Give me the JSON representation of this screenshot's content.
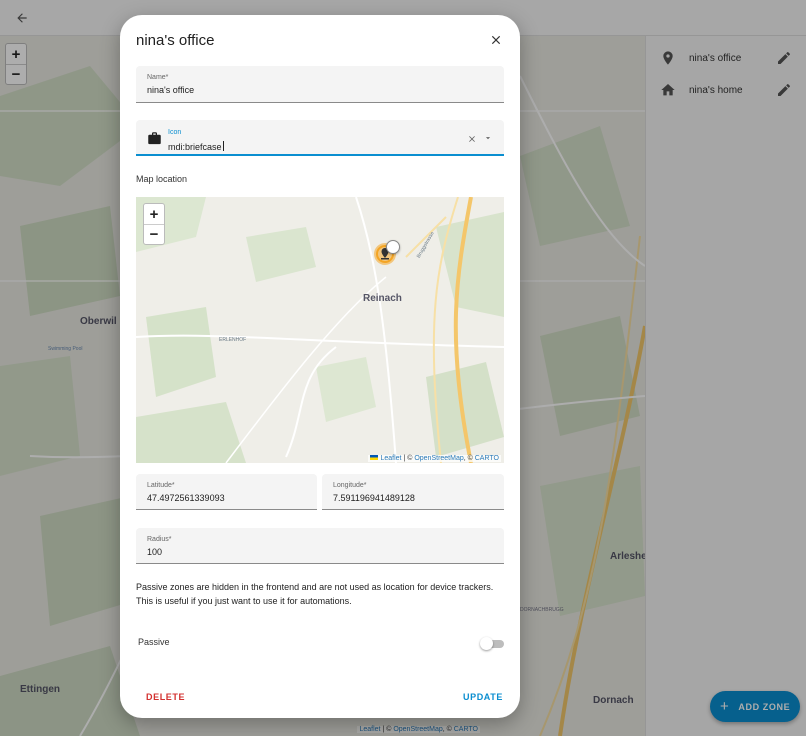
{
  "background": {
    "zoom_in": "+",
    "zoom_out": "−",
    "map_labels": {
      "oberwil": "Oberwil",
      "swimming_pool": "Swimming Pool",
      "ettingen": "Ettingen",
      "arlesheim": "Arleshei",
      "dornach": "Dornach",
      "dornachbrugg": "DORNACHBRUGG",
      "dornach_sm": "Dornach"
    },
    "attribution": {
      "leaflet": "Leaflet",
      "sep": " | © ",
      "osm": "OpenStreetMap",
      "carto_sep": ", © ",
      "carto": "CARTO"
    }
  },
  "side_list": {
    "items": [
      {
        "label": "nina's office",
        "icon": "map-marker-icon"
      },
      {
        "label": "nina's home",
        "icon": "home-icon"
      }
    ]
  },
  "fab": {
    "label": "ADD ZONE"
  },
  "dialog": {
    "title": "nina's office",
    "name_field": {
      "label": "Name*",
      "value": "nina's office"
    },
    "icon_field": {
      "label": "Icon",
      "value": "mdi:briefcase"
    },
    "map_section_label": "Map location",
    "minimap": {
      "zoom_in": "+",
      "zoom_out": "−",
      "labels": {
        "reinach": "Reinach",
        "erlenhof": "ERLENHOF",
        "road": "Bruggstrasse"
      },
      "attribution": {
        "leaflet": "Leaflet",
        "sep": " | © ",
        "osm": "OpenStreetMap",
        "carto_sep": ", © ",
        "carto": "CARTO"
      }
    },
    "latitude_field": {
      "label": "Latitude*",
      "value": "47.4972561339093"
    },
    "longitude_field": {
      "label": "Longitude*",
      "value": "7.591196941489128"
    },
    "radius_field": {
      "label": "Radius*",
      "value": "100"
    },
    "description": "Passive zones are hidden in the frontend and are not used as location for device trackers. This is useful if you just want to use it for automations.",
    "passive_label": "Passive",
    "passive_on": false,
    "delete_label": "DELETE",
    "update_label": "UPDATE"
  },
  "colors": {
    "accent": "#0a8ed0",
    "delete": "#d3302f",
    "marker": "#f4a524"
  }
}
